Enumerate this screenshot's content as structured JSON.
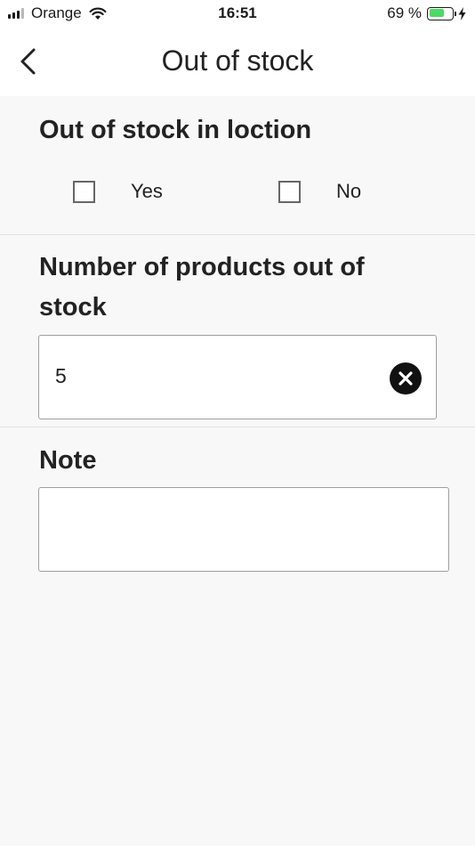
{
  "status_bar": {
    "carrier": "Orange",
    "time": "16:51",
    "battery_percent": "69 %",
    "battery_level": 0.69
  },
  "nav": {
    "title": "Out of stock",
    "back_icon": "chevron-left-icon"
  },
  "out_of_stock": {
    "label": "Out of stock in loction",
    "options": [
      {
        "label": "Yes",
        "checked": false
      },
      {
        "label": "No",
        "checked": false
      }
    ]
  },
  "products_out_of_stock": {
    "label_line1": "Number of products out of",
    "label_line2": "stock",
    "value": "5",
    "clear_icon": "clear-circle-icon"
  },
  "note": {
    "label": "Note",
    "value": ""
  }
}
